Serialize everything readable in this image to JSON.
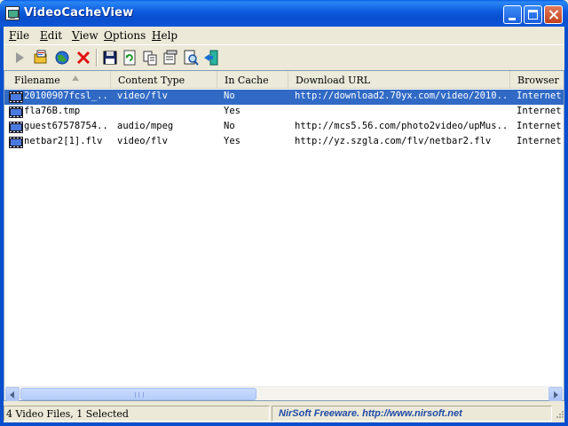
{
  "window": {
    "title": "VideoCacheView"
  },
  "menu": [
    {
      "key": "F",
      "rest": "ile"
    },
    {
      "key": "E",
      "rest": "dit"
    },
    {
      "key": "V",
      "rest": "iew"
    },
    {
      "key": "O",
      "rest": "ptions"
    },
    {
      "key": "H",
      "rest": "elp"
    }
  ],
  "toolbar": {
    "icons": [
      "play-icon",
      "open-folder-icon",
      "globe-icon",
      "delete-icon",
      "save-icon",
      "refresh-icon",
      "copy-icon",
      "properties-icon",
      "find-icon",
      "exit-icon"
    ]
  },
  "columns": [
    "Filename",
    "Content Type",
    "In Cache",
    "Download URL",
    "Browser"
  ],
  "rows": [
    {
      "filename": "20100907fcsl_...",
      "content_type": "video/flv",
      "in_cache": "No",
      "url": "http://download2.70yx.com/video/2010...",
      "browser": "Internet",
      "selected": true
    },
    {
      "filename": "fla76B.tmp",
      "content_type": "",
      "in_cache": "Yes",
      "url": "",
      "browser": "Internet",
      "selected": false
    },
    {
      "filename": "guest67578754...",
      "content_type": "audio/mpeg",
      "in_cache": "No",
      "url": "http://mcs5.56.com/photo2video/upMus...",
      "browser": "Internet",
      "selected": false
    },
    {
      "filename": "netbar2[1].flv",
      "content_type": "video/flv",
      "in_cache": "Yes",
      "url": "http://yz.szgla.com/flv/netbar2.flv",
      "browser": "Internet",
      "selected": false
    }
  ],
  "status": {
    "count": "4 Video Files, 1 Selected",
    "credit": "NirSoft Freeware.  http://www.nirsoft.net"
  },
  "colors": {
    "selection": "#316ac5",
    "titlebar": "#0a4fcd",
    "credit_text": "#1f4aa8"
  }
}
